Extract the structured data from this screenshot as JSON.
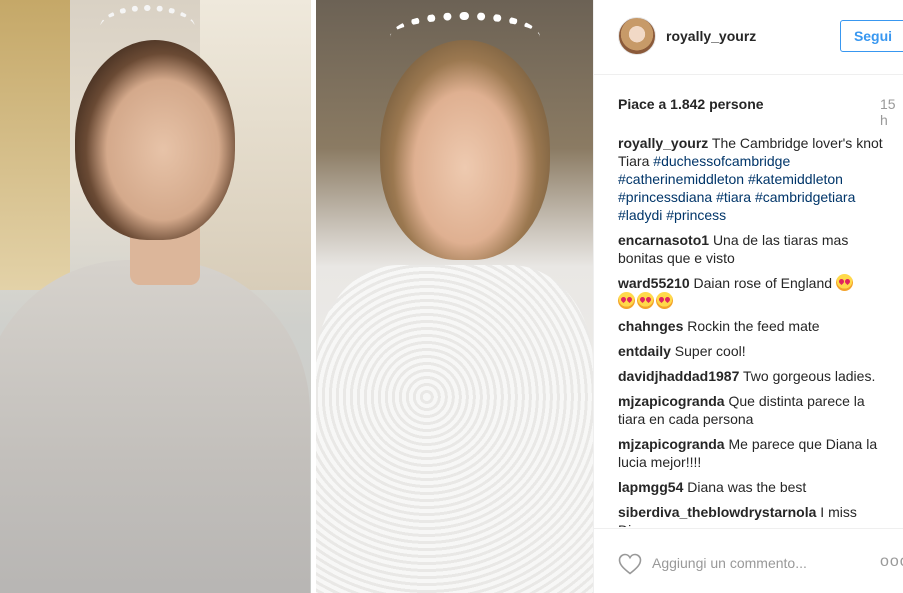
{
  "post": {
    "username": "royally_yourz",
    "follow_label": "Segui",
    "likes": "Piace a 1.842 persone",
    "time": "15 h",
    "caption": {
      "user": "royally_yourz",
      "text": "The Cambridge lover's knot Tiara",
      "hashtags": [
        "#duchessofcambridge",
        "#catherinemiddleton",
        "#katemiddleton",
        "#princessdiana",
        "#tiara",
        "#cambridgetiara",
        "#ladydi",
        "#princess"
      ]
    },
    "comments": [
      {
        "user": "encarnasoto1",
        "text": "Una de las tiaras mas bonitas que e visto"
      },
      {
        "user": "ward55210",
        "text": "Daian rose of England"
      },
      {
        "user": "chahnges",
        "text": "Rockin the feed mate"
      },
      {
        "user": "entdaily",
        "text": "Super cool!"
      },
      {
        "user": "davidjhaddad1987",
        "text": "Two gorgeous ladies."
      },
      {
        "user": "mjzapicogranda",
        "text": "Que distinta parece la tiara en cada persona"
      },
      {
        "user": "mjzapicogranda",
        "text": "Me parece que Diana la lucia mejor!!!!"
      },
      {
        "user": "lapmgg54",
        "text": "Diana was the best"
      },
      {
        "user": "siberdiva_theblowdrystarnola",
        "text": "I miss Diana"
      }
    ],
    "comment_placeholder": "Aggiungi un commento...",
    "more_label": "ooo"
  },
  "colors": {
    "accent": "#3897f0",
    "hashtag": "#003569",
    "muted": "#999999",
    "text": "#262626"
  },
  "icons": {
    "heart": "heart-icon",
    "more": "more-options-icon",
    "emoji": "heart-eyes-emoji-icon"
  }
}
